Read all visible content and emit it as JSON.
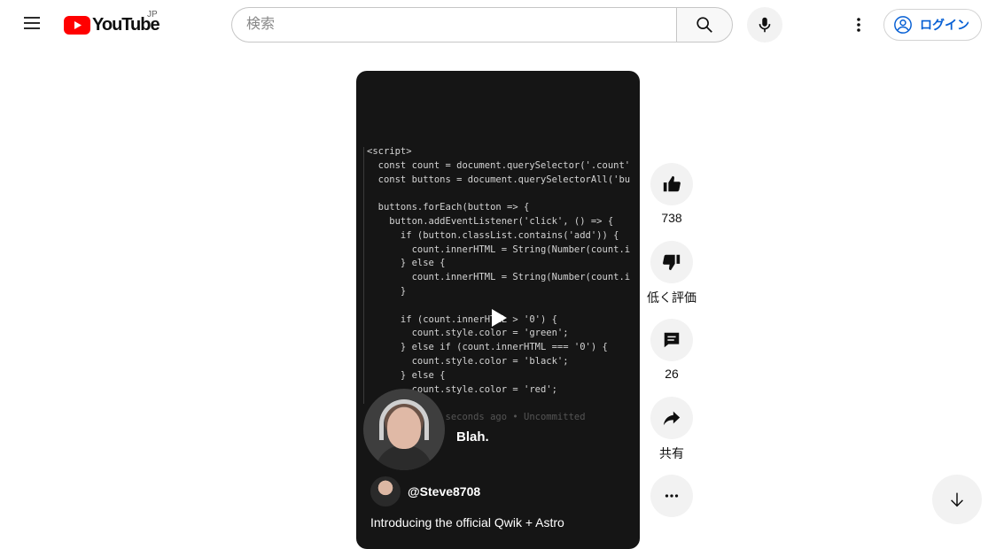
{
  "header": {
    "logo_text": "YouTube",
    "region": "JP",
    "search_placeholder": "検索",
    "login_label": "ログイン"
  },
  "icons": {
    "menu": "hamburger-menu-icon",
    "search": "search-icon",
    "mic": "microphone-icon",
    "more": "more-vert-icon",
    "account": "account-circle-icon",
    "like": "thumb-up-icon",
    "dislike": "thumb-down-icon",
    "comment": "comment-icon",
    "share": "share-icon",
    "more_horiz": "more-horiz-icon",
    "next": "arrow-down-icon",
    "play": "play-icon"
  },
  "colors": {
    "brand_red": "#ff0000",
    "link_blue": "#065fd4",
    "action_bg": "#f2f2f2"
  },
  "short": {
    "code_lines": [
      "<script>",
      "  const count = document.querySelector('.count'",
      "  const buttons = document.querySelectorAll('bu",
      "",
      "  buttons.forEach(button => {",
      "    button.addEventListener('click', () => {",
      "      if (button.classList.contains('add')) {",
      "        count.innerHTML = String(Number(count.i",
      "      } else {",
      "        count.innerHTML = String(Number(count.i",
      "      }",
      "",
      "      if (count.innerHTML > '0') {",
      "        count.style.color = 'green';",
      "      } else if (count.innerHTML === '0') {",
      "        count.style.color = 'black';",
      "      } else {",
      "        count.style.color = 'red';"
    ],
    "code_hint": "You, 16 seconds ago • Uncommitted",
    "caption": "Blah.",
    "channel": "@Steve8708",
    "title": "Introducing the official Qwik + Astro"
  },
  "actions": {
    "like_count": "738",
    "dislike_label": "低く評価",
    "comment_count": "26",
    "share_label": "共有"
  }
}
